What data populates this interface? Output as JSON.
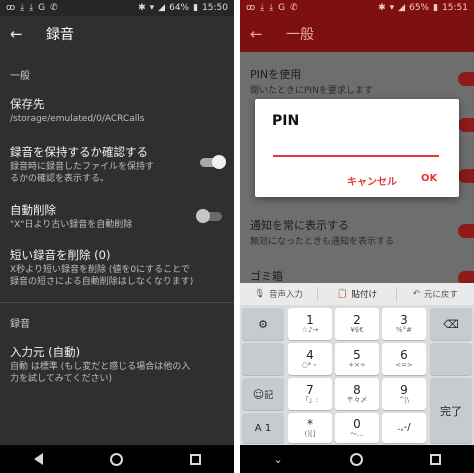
{
  "left": {
    "status": {
      "time": "15:50",
      "battery": "64%"
    },
    "appbar": {
      "back_glyph": "←",
      "title": "録音"
    },
    "sections": {
      "general": "一般",
      "recording": "録音"
    },
    "prefs": {
      "save_dest": {
        "title": "保存先",
        "summary": "/storage/emulated/0/ACRCalls"
      },
      "confirm_keep": {
        "title": "録音を保持するか確認する",
        "summary1": "録音時に録音したファイルを保持す",
        "summary2": "るかの確認を表示する。",
        "enabled": true
      },
      "auto_delete": {
        "title": "自動削除",
        "summary": "\"X\"日より古い録音を自動削除",
        "enabled": false
      },
      "delete_short": {
        "title": "短い録音を削除 (0)",
        "summary1": "X秒より短い録音を削除 (値を0にすることで",
        "summary2": "録音の短さによる自動削除はしなくなります)"
      },
      "input_source": {
        "title": "入力元 (自動)",
        "summary1": "自動 は標準 (もし変だと感じる場合は他の入",
        "summary2": "力を試してみてください)"
      }
    }
  },
  "right": {
    "status": {
      "time": "15:51",
      "battery": "65%"
    },
    "appbar": {
      "back_glyph": "←",
      "title": "一般"
    },
    "list": {
      "pin": {
        "title": "PINを使用",
        "summary": "開いたときにPINを要求します"
      },
      "notify": {
        "title": "通知を常に表示する",
        "summary": "無効になったときも通知を表示する"
      },
      "trash": {
        "title": "ゴミ箱"
      }
    },
    "dialog": {
      "title": "PIN",
      "cancel": "キャンセル",
      "ok": "OK",
      "value": ""
    },
    "kb_toolbar": {
      "voice": "音声入力",
      "paste": "貼付け",
      "undo": "元に戻す"
    },
    "keys": {
      "k1": {
        "main": "1",
        "sub": "☆♪→"
      },
      "k2": {
        "main": "2",
        "sub": "¥$€"
      },
      "k3": {
        "main": "3",
        "sub": "%°#"
      },
      "k4": {
        "main": "4",
        "sub": "○*・"
      },
      "k5": {
        "main": "5",
        "sub": "+×÷"
      },
      "k6": {
        "main": "6",
        "sub": "<=>"
      },
      "k7": {
        "main": "7",
        "sub": "「」:"
      },
      "k8": {
        "main": "8",
        "sub": "〒々〆"
      },
      "k9": {
        "main": "9",
        "sub": "^|\\"
      },
      "k0": {
        "main": "0",
        "sub": "〜…"
      },
      "kstar": {
        "main": "*",
        "sub": ""
      },
      "kparen": {
        "main": "()[]",
        "sub": ""
      },
      "kdot": {
        "main": ".,-/",
        "sub": ""
      },
      "emoji_label": "記",
      "mode_label": "A 1",
      "done_label": "完了"
    }
  }
}
